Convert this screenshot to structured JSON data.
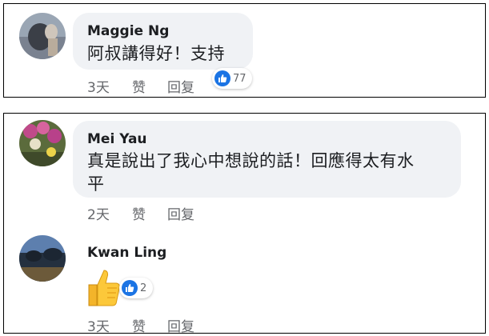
{
  "comments": [
    {
      "author": "Maggie Ng",
      "text": "阿叔講得好！支持",
      "time": "3天",
      "like_label": "赞",
      "reply_label": "回复",
      "reaction_count": "77"
    },
    {
      "author": "Mei Yau",
      "text_line1": "真是說出了我心中想說的話！回應得太有水",
      "text_line2": "平",
      "time": "2天",
      "like_label": "赞",
      "reply_label": "回复"
    },
    {
      "author": "Kwan Ling",
      "sticker": "thumbs-up-emoji",
      "time": "3天",
      "like_label": "赞",
      "reply_label": "回复",
      "reaction_count": "2"
    }
  ],
  "colors": {
    "bubble": "#f0f2f5",
    "meta_text": "#65676b",
    "like_blue": "#1b74e4",
    "border": "#000000"
  },
  "icons": [
    "like-reaction-icon",
    "thumbs-up-sticker-icon"
  ]
}
